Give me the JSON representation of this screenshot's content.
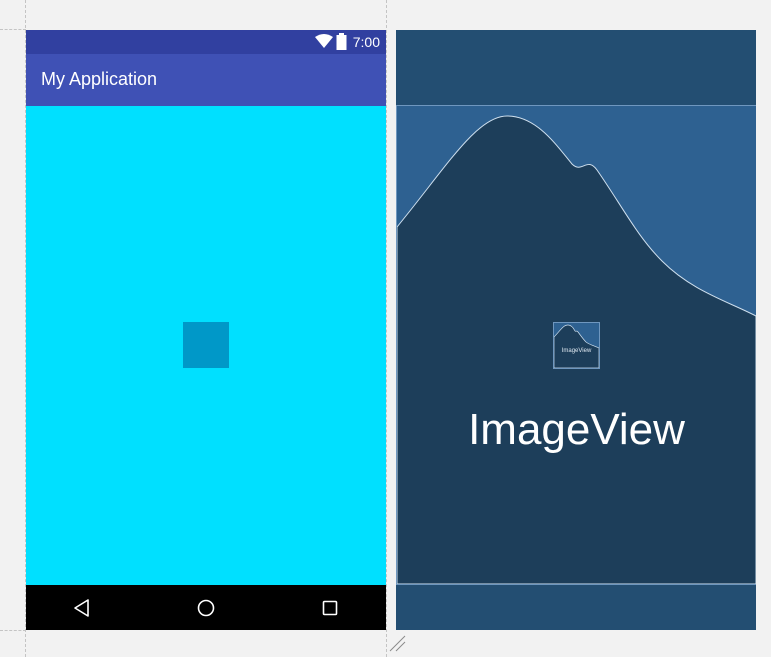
{
  "status_bar": {
    "time": "7:00"
  },
  "app_bar": {
    "title": "My Application"
  },
  "blueprint": {
    "component_label": "ImageView",
    "thumbnail_label": "ImageView"
  },
  "colors": {
    "status_bar": "#3140a0",
    "app_bar": "#3f51b5",
    "content_background": "#00e0ff",
    "image_view": "#0098c8",
    "blueprint_background": "#234e72",
    "blueprint_mountain": "#1d3e5a",
    "blueprint_sky": "#2e6191"
  },
  "icons": {
    "status": [
      "wifi-icon",
      "battery-icon"
    ],
    "navigation": [
      "back-triangle-icon",
      "home-circle-icon",
      "recents-square-icon"
    ]
  }
}
